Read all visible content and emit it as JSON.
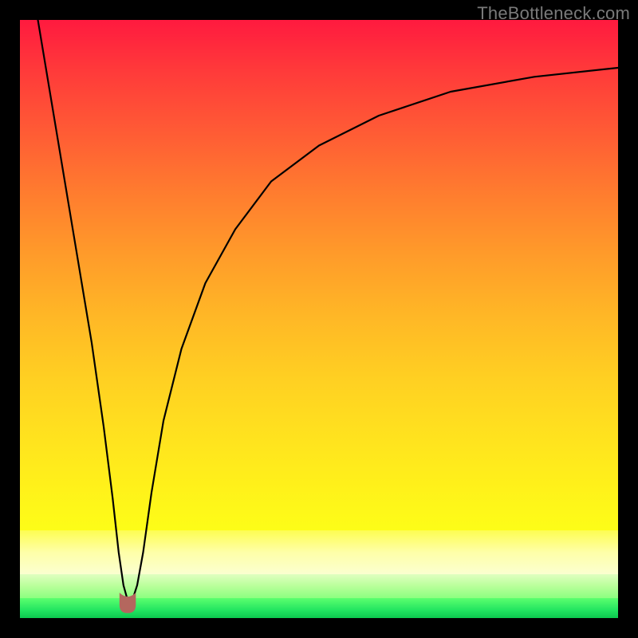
{
  "watermark": {
    "text": "TheBottleneck.com"
  },
  "chart_data": {
    "type": "line",
    "title": "",
    "xlabel": "",
    "ylabel": "",
    "xlim": [
      0,
      100
    ],
    "ylim": [
      0,
      100
    ],
    "grid": false,
    "legend": false,
    "background_gradient": {
      "orientation": "vertical",
      "stops": [
        {
          "pos": 0.0,
          "color": "#ff1a3f"
        },
        {
          "pos": 0.35,
          "color": "#ff7a2f"
        },
        {
          "pos": 0.7,
          "color": "#ffe41e"
        },
        {
          "pos": 0.86,
          "color": "#feffa8"
        },
        {
          "pos": 0.94,
          "color": "#8cff80"
        },
        {
          "pos": 1.0,
          "color": "#0cc94f"
        }
      ]
    },
    "series": [
      {
        "name": "bottleneck-curve",
        "x": [
          3,
          6,
          9,
          12,
          14,
          15.5,
          16.5,
          17.3,
          18.0,
          18.8,
          19.6,
          20.6,
          22,
          24,
          27,
          31,
          36,
          42,
          50,
          60,
          72,
          86,
          100
        ],
        "y": [
          100,
          82,
          64,
          46,
          32,
          20,
          11,
          5.5,
          3.0,
          3.0,
          5.5,
          11,
          21,
          33,
          45,
          56,
          65,
          73,
          79,
          84,
          88,
          90.5,
          92
        ]
      }
    ],
    "marker": {
      "name": "curve-minimum-nub",
      "x": 18.0,
      "y": 2.5,
      "width": 2.6,
      "height": 3.2,
      "color": "#b4675e"
    }
  }
}
